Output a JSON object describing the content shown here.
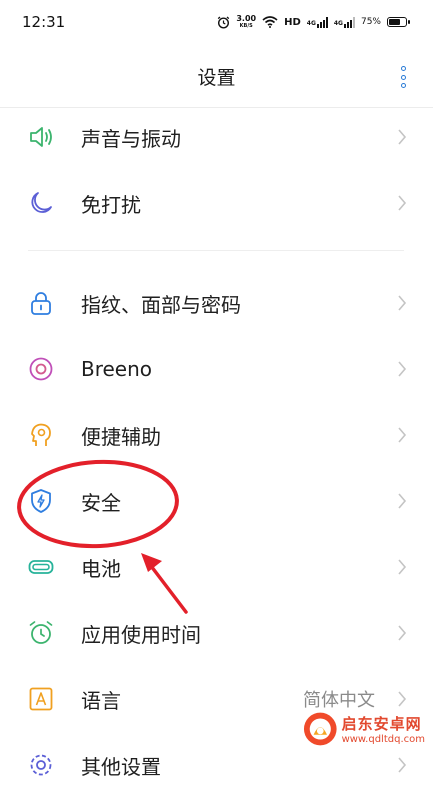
{
  "status_bar": {
    "time": "12:31",
    "net_speed": "3.00",
    "net_unit": "KB/S",
    "hd": "HD",
    "sim1": "4G",
    "sim2": "4G",
    "battery": "75%",
    "battery_level": 0.75
  },
  "header": {
    "title": "设置"
  },
  "settings": {
    "items": [
      {
        "label": "声音与振动",
        "icon": "speaker-icon",
        "color": "#3cb46e"
      },
      {
        "label": "免打扰",
        "icon": "moon-icon",
        "color": "#5b5fd6"
      },
      {
        "label": "指纹、面部与密码",
        "icon": "lock-icon",
        "color": "#2f7ee0"
      },
      {
        "label": "Breeno",
        "icon": "breeno-icon",
        "color": "#c04fb8"
      },
      {
        "label": "便捷辅助",
        "icon": "head-gear-icon",
        "color": "#f0a020"
      },
      {
        "label": "安全",
        "icon": "shield-icon",
        "color": "#2f7ee0"
      },
      {
        "label": "电池",
        "icon": "battery-icon",
        "color": "#27b39a"
      },
      {
        "label": "应用使用时间",
        "icon": "clock-icon",
        "color": "#3cb46e"
      },
      {
        "label": "语言",
        "icon": "language-icon",
        "color": "#f0a020",
        "value": "简体中文"
      },
      {
        "label": "其他设置",
        "icon": "gear-icon",
        "color": "#5b5fd6"
      }
    ]
  },
  "annotation": {
    "highlight_color": "#e3202a"
  },
  "watermark": {
    "title": "启东安卓网",
    "url": "www.qdltdq.com"
  }
}
